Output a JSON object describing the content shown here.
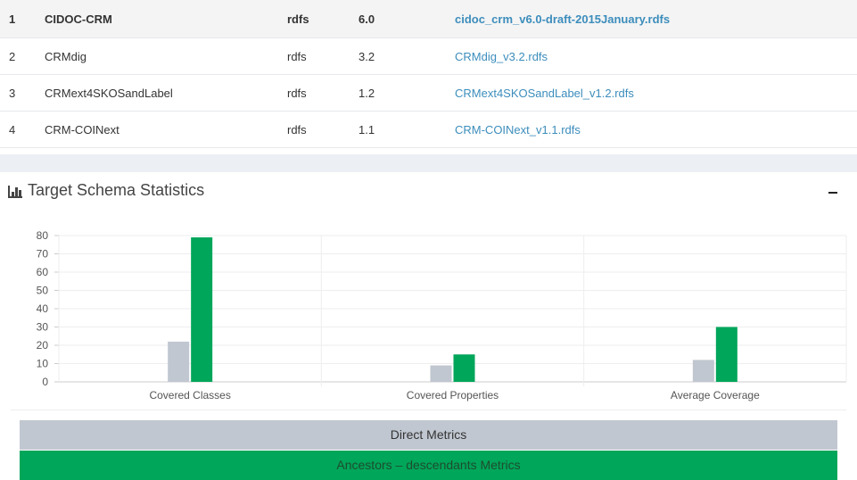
{
  "schemas": [
    {
      "index": "1",
      "name": "CIDOC-CRM",
      "format": "rdfs",
      "version": "6.0",
      "file": "cidoc_crm_v6.0-draft-2015January.rdfs"
    },
    {
      "index": "2",
      "name": "CRMdig",
      "format": "rdfs",
      "version": "3.2",
      "file": "CRMdig_v3.2.rdfs"
    },
    {
      "index": "3",
      "name": "CRMext4SKOSandLabel",
      "format": "rdfs",
      "version": "1.2",
      "file": "CRMext4SKOSandLabel_v1.2.rdfs"
    },
    {
      "index": "4",
      "name": "CRM-COINext",
      "format": "rdfs",
      "version": "1.1",
      "file": "CRM-COINext_v1.1.rdfs"
    }
  ],
  "stats_box": {
    "title": "Target Schema Statistics",
    "icon": "bar-chart-icon",
    "collapse_icon": "minus-icon"
  },
  "chart_data": {
    "type": "bar",
    "categories": [
      "Covered Classes",
      "Covered Properties",
      "Average Coverage"
    ],
    "series": [
      {
        "name": "Direct Metrics",
        "color": "#c1c7d0",
        "values": [
          22,
          9,
          12
        ]
      },
      {
        "name": "Ancestors – descendants Metrics",
        "color": "#00a65a",
        "values": [
          79,
          15,
          30
        ]
      }
    ],
    "yticks": [
      "0",
      "10",
      "20",
      "30",
      "40",
      "50",
      "60",
      "70",
      "80"
    ],
    "ylim": [
      0,
      80
    ],
    "grid": true,
    "legend_position": "bottom"
  },
  "colors": {
    "link": "#3c8dbc",
    "direct": "#c1c7d0",
    "ancestors": "#00a65a"
  }
}
